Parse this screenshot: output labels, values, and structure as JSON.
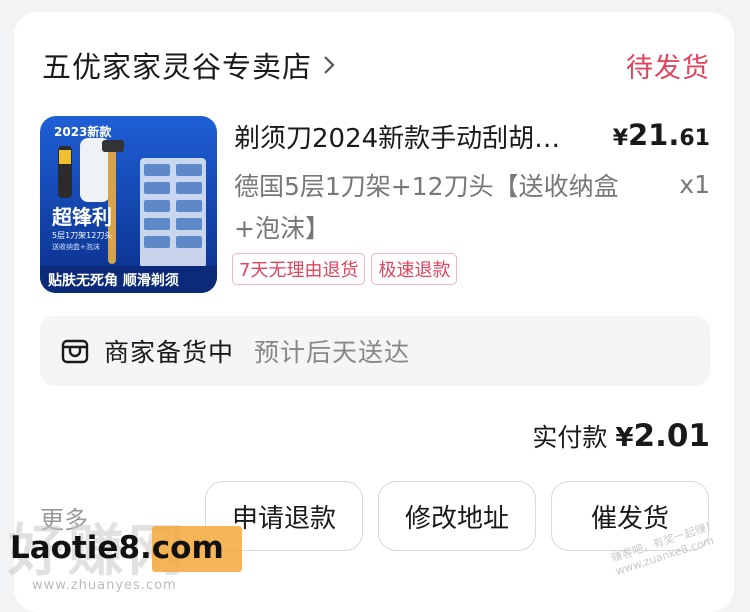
{
  "shop": {
    "name": "五优家家灵谷专卖店",
    "status": "待发货"
  },
  "product": {
    "title": "剃须刀2024新款手动刮胡…",
    "price_currency": "¥",
    "price_int": "21.",
    "price_dec": "61",
    "variant": "德国5层1刀架+12刀头【送收纳盒+泡沫】",
    "qty": "x1",
    "tags": [
      "7天无理由退货",
      "极速退款"
    ],
    "image": {
      "badge": "2023新款",
      "headline": "超锋利",
      "subline": "5层1刀架12刀头",
      "subline2": "送收纳盒+泡沫",
      "footer": "贴肤无死角 顺滑剃须"
    }
  },
  "notice": {
    "main": "商家备货中",
    "sub": "预计后天送达"
  },
  "payment": {
    "label": "实付款",
    "currency": "¥",
    "amount": "2.01"
  },
  "actions": {
    "more": "更多",
    "refund": "申请退款",
    "change_address": "修改地址",
    "urge": "催发货"
  },
  "watermark": {
    "main": "Laotie8.com",
    "chinese": "好赚网",
    "sub": "www.zhuanyes.com",
    "right": "赚客吧，有奖一起赚！www.zuanke8.com"
  },
  "colors": {
    "accent": "#e1445c",
    "text": "#1a1a1a",
    "muted": "#777777"
  }
}
